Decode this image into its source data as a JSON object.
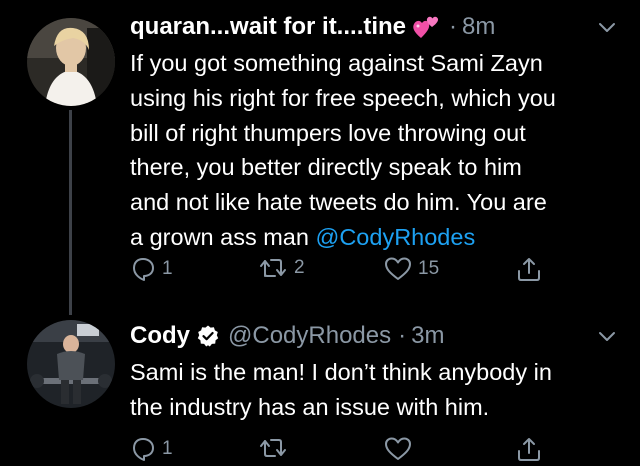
{
  "tweets": [
    {
      "display_name": "quaran...wait for it....tine",
      "name_emoji": "two-hearts-emoji",
      "time": "8m",
      "text_lines": [
        "If you got something against Sami Zayn",
        "using his right for free speech, which you",
        "bill of right thumpers love throwing out",
        "there, you better directly speak to him",
        "and not like hate tweets do him. You are"
      ],
      "text_last_prefix": "a grown ass man ",
      "mention": "@CodyRhodes",
      "reply_count": "1",
      "retweet_count": "2",
      "like_count": "15"
    },
    {
      "display_name": "Cody",
      "verified": true,
      "handle": "@CodyRhodes",
      "time": "3m",
      "text_lines": [
        "Sami is the man! I don’t think anybody in",
        "the industry has an issue with him."
      ],
      "reply_count": "1",
      "retweet_count": "",
      "like_count": ""
    }
  ],
  "colors": {
    "background": "#000000",
    "text": "#ffffff",
    "secondary": "#8b98a5",
    "link": "#1da1f2",
    "thread_line": "#3d4148"
  }
}
